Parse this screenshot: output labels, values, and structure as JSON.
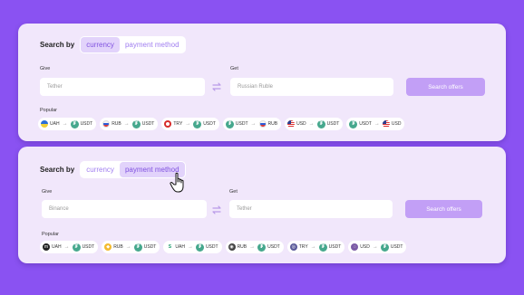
{
  "search_currency": {
    "search_by_label": "Search by",
    "options": [
      "currency",
      "payment method"
    ],
    "active": "currency",
    "give_label": "Give",
    "give_value": "Tether",
    "get_label": "Get",
    "get_value": "Russian Ruble",
    "search_button": "Search offers",
    "popular_label": "Popular",
    "popular": [
      {
        "from_icon": "ukraine-flag-icon",
        "from": "UAH",
        "to_icon": "tether-icon",
        "to": "USDT"
      },
      {
        "from_icon": "russia-flag-icon",
        "from": "RUB",
        "to_icon": "tether-icon",
        "to": "USDT"
      },
      {
        "from_icon": "turkey-flag-icon",
        "from": "TRY",
        "to_icon": "tether-icon",
        "to": "USDT"
      },
      {
        "from_icon": "tether-icon",
        "from": "USDT",
        "to_icon": "russia-flag-icon",
        "to": "RUB"
      },
      {
        "from_icon": "usa-flag-icon",
        "from": "USD",
        "to_icon": "tether-icon",
        "to": "USDT"
      },
      {
        "from_icon": "tether-icon",
        "from": "USDT",
        "to_icon": "usa-flag-icon",
        "to": "USD"
      }
    ]
  },
  "search_payment": {
    "search_by_label": "Search by",
    "options": [
      "currency",
      "payment method"
    ],
    "active": "payment method",
    "give_label": "Give",
    "give_value": "Binance",
    "get_label": "Get",
    "get_value": "Tether",
    "search_button": "Search offers",
    "popular_label": "Popular",
    "popular": [
      {
        "from_icon": "monobank-icon",
        "from": "UAH",
        "to_icon": "tether-icon",
        "to": "USDT"
      },
      {
        "from_icon": "binance-icon",
        "from": "RUB",
        "to_icon": "tether-icon",
        "to": "USDT"
      },
      {
        "from_icon": "revolut-icon",
        "from": "UAH",
        "to_icon": "tether-icon",
        "to": "USDT"
      },
      {
        "from_icon": "qiwi-icon",
        "from": "RUB",
        "to_icon": "tether-icon",
        "to": "USDT"
      },
      {
        "from_icon": "ziraat-icon",
        "from": "TRY",
        "to_icon": "tether-icon",
        "to": "USDT"
      },
      {
        "from_icon": "viber-icon",
        "from": "USD",
        "to_icon": "tether-icon",
        "to": "USDT"
      }
    ]
  },
  "colors": {
    "background": "#8a52f2",
    "card": "#f1e7fb",
    "accent": "#c29ff6",
    "tether": "#46a88d"
  }
}
